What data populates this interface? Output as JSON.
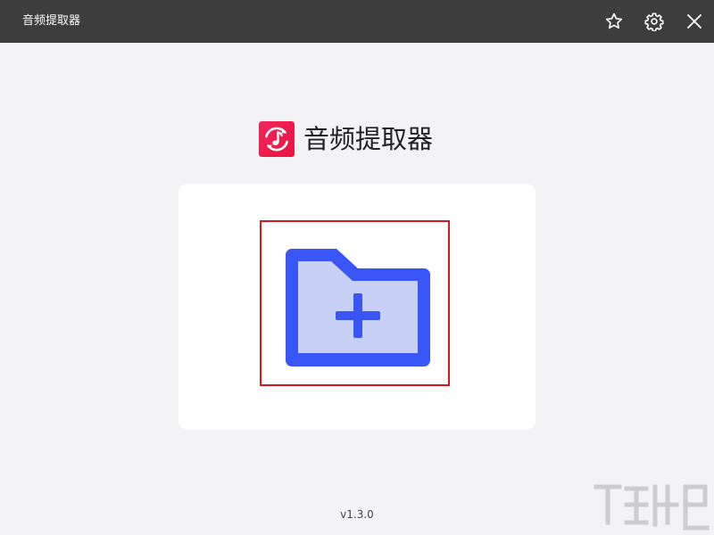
{
  "window": {
    "title": "音频提取器"
  },
  "titlebar": {
    "icons": [
      "star-icon",
      "gear-icon",
      "close-icon"
    ]
  },
  "brand": {
    "logo_icon": "music-note-refresh-icon",
    "name": "音频提取器"
  },
  "main": {
    "add_folder_icon": "folder-add-icon"
  },
  "footer": {
    "version": "v1.3.0"
  },
  "colors": {
    "titlebar_bg": "#3d3d3d",
    "accent_blue": "#3a55f5",
    "folder_fill": "#c9d0f8",
    "highlight_border": "#e0141e",
    "logo_red": "#ee1d52"
  }
}
